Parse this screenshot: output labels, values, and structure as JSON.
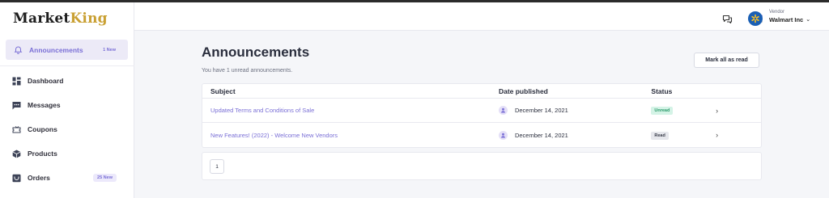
{
  "brand": {
    "logo_part1": "Market",
    "logo_part2": "King"
  },
  "profile": {
    "role": "Vendor",
    "company": "Walmart Inc"
  },
  "sidebar": {
    "items": [
      {
        "label": "Announcements",
        "badge": "1 New",
        "icon": "bell-icon"
      },
      {
        "label": "Dashboard",
        "icon": "dashboard-icon"
      },
      {
        "label": "Messages",
        "icon": "chat-icon"
      },
      {
        "label": "Coupons",
        "icon": "coupon-icon"
      },
      {
        "label": "Products",
        "icon": "box-icon"
      },
      {
        "label": "Orders",
        "badge": "25 New",
        "icon": "orders-icon"
      }
    ]
  },
  "page": {
    "title": "Announcements",
    "subtitle": "You have 1 unread announcements.",
    "mark_all_label": "Mark all as read"
  },
  "table": {
    "headers": [
      "Subject",
      "Date published",
      "Status"
    ],
    "rows": [
      {
        "subject": "Updated Terms and Conditions of Sale",
        "date": "December 14, 2021",
        "status": "Unread"
      },
      {
        "subject": "New Features! (2022) - Welcome New Vendors",
        "date": "December 14, 2021",
        "status": "Read"
      }
    ]
  },
  "pagination": {
    "current_page": "1"
  },
  "colors": {
    "accent": "#7a6fd6",
    "unread": "#2a9a6a",
    "avatar": "#1a5fb4"
  }
}
